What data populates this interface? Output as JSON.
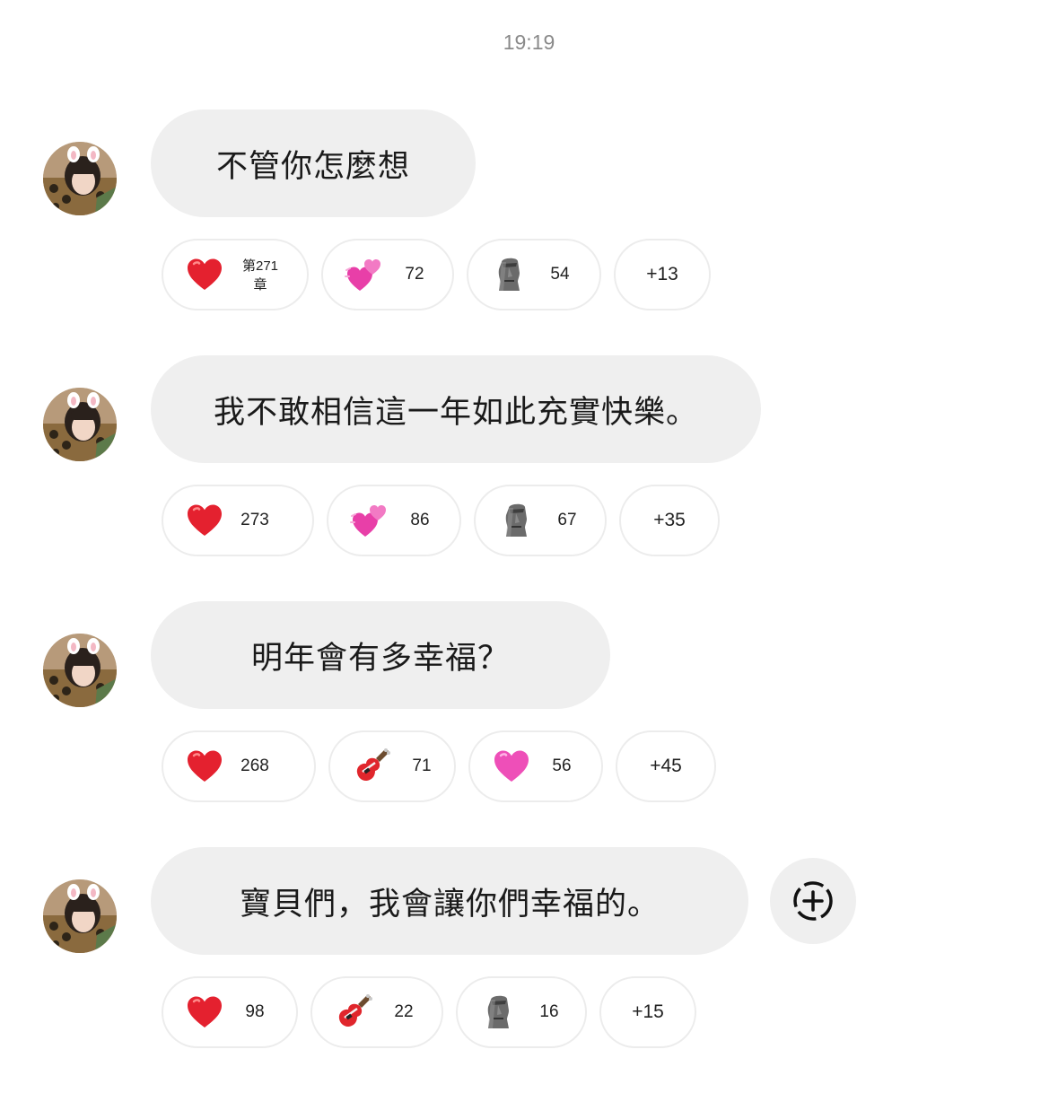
{
  "timestamp": "19:19",
  "messages": [
    {
      "text": "不管你怎麼想",
      "reactions": [
        {
          "emoji": "heart-icon",
          "count": "第271章"
        },
        {
          "emoji": "two-hearts-icon",
          "count": "72"
        },
        {
          "emoji": "moai-icon",
          "count": "54"
        }
      ],
      "more": "+13"
    },
    {
      "text": "我不敢相信這一年如此充實快樂。",
      "reactions": [
        {
          "emoji": "heart-icon",
          "count": "273"
        },
        {
          "emoji": "two-hearts-icon",
          "count": "86"
        },
        {
          "emoji": "moai-icon",
          "count": "67"
        }
      ],
      "more": "+35"
    },
    {
      "text": "明年會有多幸福？",
      "reactions": [
        {
          "emoji": "heart-icon",
          "count": "268"
        },
        {
          "emoji": "guitar-icon",
          "count": "71"
        },
        {
          "emoji": "pink-heart-icon",
          "count": "56"
        }
      ],
      "more": "+45"
    },
    {
      "text": "寶貝們，我會讓你們幸福的。",
      "reactions": [
        {
          "emoji": "heart-icon",
          "count": "98"
        },
        {
          "emoji": "guitar-icon",
          "count": "22"
        },
        {
          "emoji": "moai-icon",
          "count": "16"
        }
      ],
      "more": "+15"
    }
  ],
  "colors": {
    "bubble": "#efefef",
    "red_heart": "#e4212f",
    "pink_heart": "#ee4fb8",
    "timestamp": "#8a8a8a"
  }
}
